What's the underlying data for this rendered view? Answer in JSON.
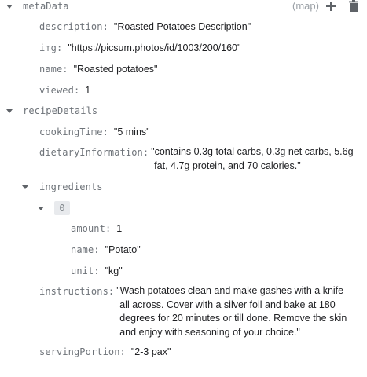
{
  "metaData": {
    "key": "metaData",
    "type_tag": "(map)",
    "fields": [
      {
        "key": "description:",
        "value": "\"Roasted Potatoes Description\""
      },
      {
        "key": "img:",
        "value": "\"https://picsum.photos/id/1003/200/160\""
      },
      {
        "key": "name:",
        "value": "\"Roasted potatoes\""
      },
      {
        "key": "viewed:",
        "value": "1"
      }
    ]
  },
  "recipeDetails": {
    "key": "recipeDetails",
    "cookingTime": {
      "key": "cookingTime:",
      "value": "\"5 mins\""
    },
    "dietaryInformation": {
      "key": "dietaryInformation:",
      "value": "\"contains 0.3g total carbs, 0.3g net carbs, 5.6g fat, 4.7g protein, and 70 calories.\""
    },
    "ingredients": {
      "key": "ingredients",
      "items": [
        {
          "index": "0",
          "fields": [
            {
              "key": "amount:",
              "value": "1"
            },
            {
              "key": "name:",
              "value": "\"Potato\""
            },
            {
              "key": "unit:",
              "value": "\"kg\""
            }
          ]
        }
      ]
    },
    "instructions": {
      "key": "instructions:",
      "value": "\"Wash potatoes clean and make gashes with a knife all across. Cover with a silver foil and bake at 180 degrees for 20 minutes or till done. Remove the skin and enjoy with seasoning of your choice.\""
    },
    "servingPortion": {
      "key": "servingPortion:",
      "value": "\"2-3 pax\""
    }
  },
  "icons": {
    "expand": "chevron-down-icon",
    "add": "plus-icon",
    "delete": "trash-icon"
  },
  "colors": {
    "key_text": "#6e7379",
    "value_text": "#202124",
    "caret": "#5f6368",
    "index_chip_bg": "#e8eaed",
    "icon": "#5f6368"
  }
}
